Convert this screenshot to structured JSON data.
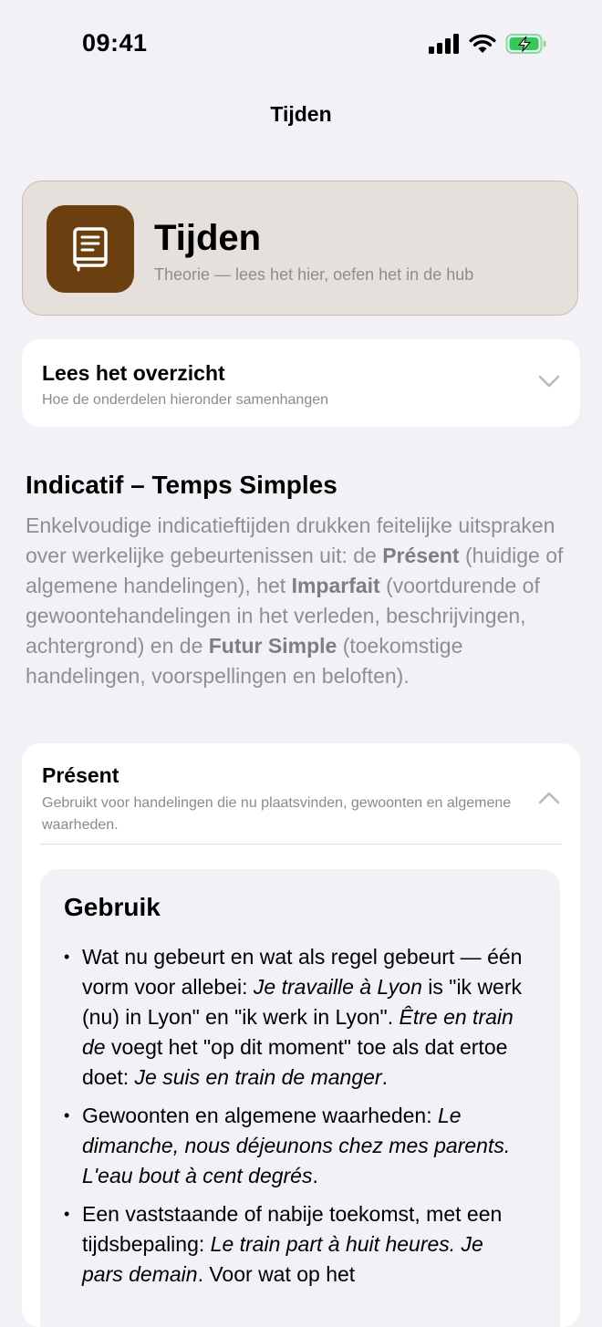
{
  "status_bar": {
    "time": "09:41"
  },
  "nav": {
    "title": "Tijden"
  },
  "hero": {
    "title": "Tijden",
    "subtitle": "Theorie — lees het hier, oefen het in de hub",
    "icon": "book-icon",
    "accent_color": "#6b3f0f"
  },
  "overview": {
    "title": "Lees het overzicht",
    "subtitle": "Hoe de onderdelen hieronder samenhangen"
  },
  "section": {
    "title": "Indicatif – Temps Simples",
    "body": [
      {
        "t": "Enkelvoudige indicatieftijden drukken feitelijke uitspraken over werkelijke gebeurtenissen uit: de "
      },
      {
        "t": "Présent",
        "b": true
      },
      {
        "t": " (huidige of algemene handelingen), het "
      },
      {
        "t": "Imparfait",
        "b": true
      },
      {
        "t": " (voortdurende of gewoontehandelingen in het verleden, beschrijvingen, achtergrond) en de "
      },
      {
        "t": "Futur Simple",
        "b": true
      },
      {
        "t": " (toekomstige handelingen, voorspellingen en beloften)."
      }
    ]
  },
  "present": {
    "title": "Présent",
    "subtitle": "Gebruikt voor handelingen die nu plaatsvinden, gewoonten en algemene waarheden.",
    "usage_heading": "Gebruik",
    "usage_items": [
      [
        {
          "t": "Wat nu gebeurt en wat als regel gebeurt — één vorm voor allebei: "
        },
        {
          "t": "Je travaille à Lyon",
          "i": true
        },
        {
          "t": " is \"ik werk (nu) in Lyon\" en \"ik werk in Lyon\". "
        },
        {
          "t": "Être en train de",
          "i": true
        },
        {
          "t": " voegt het \"op dit moment\" toe als dat ertoe doet: "
        },
        {
          "t": "Je suis en train de manger",
          "i": true
        },
        {
          "t": "."
        }
      ],
      [
        {
          "t": "Gewoonten en algemene waarheden: "
        },
        {
          "t": "Le dimanche, nous déjeunons chez mes parents. L'eau bout à cent degrés",
          "i": true
        },
        {
          "t": "."
        }
      ],
      [
        {
          "t": "Een vaststaande of nabije toekomst, met een tijdsbepaling: "
        },
        {
          "t": "Le train part à huit heures. Je pars demain",
          "i": true
        },
        {
          "t": ". Voor wat op het"
        }
      ]
    ]
  }
}
